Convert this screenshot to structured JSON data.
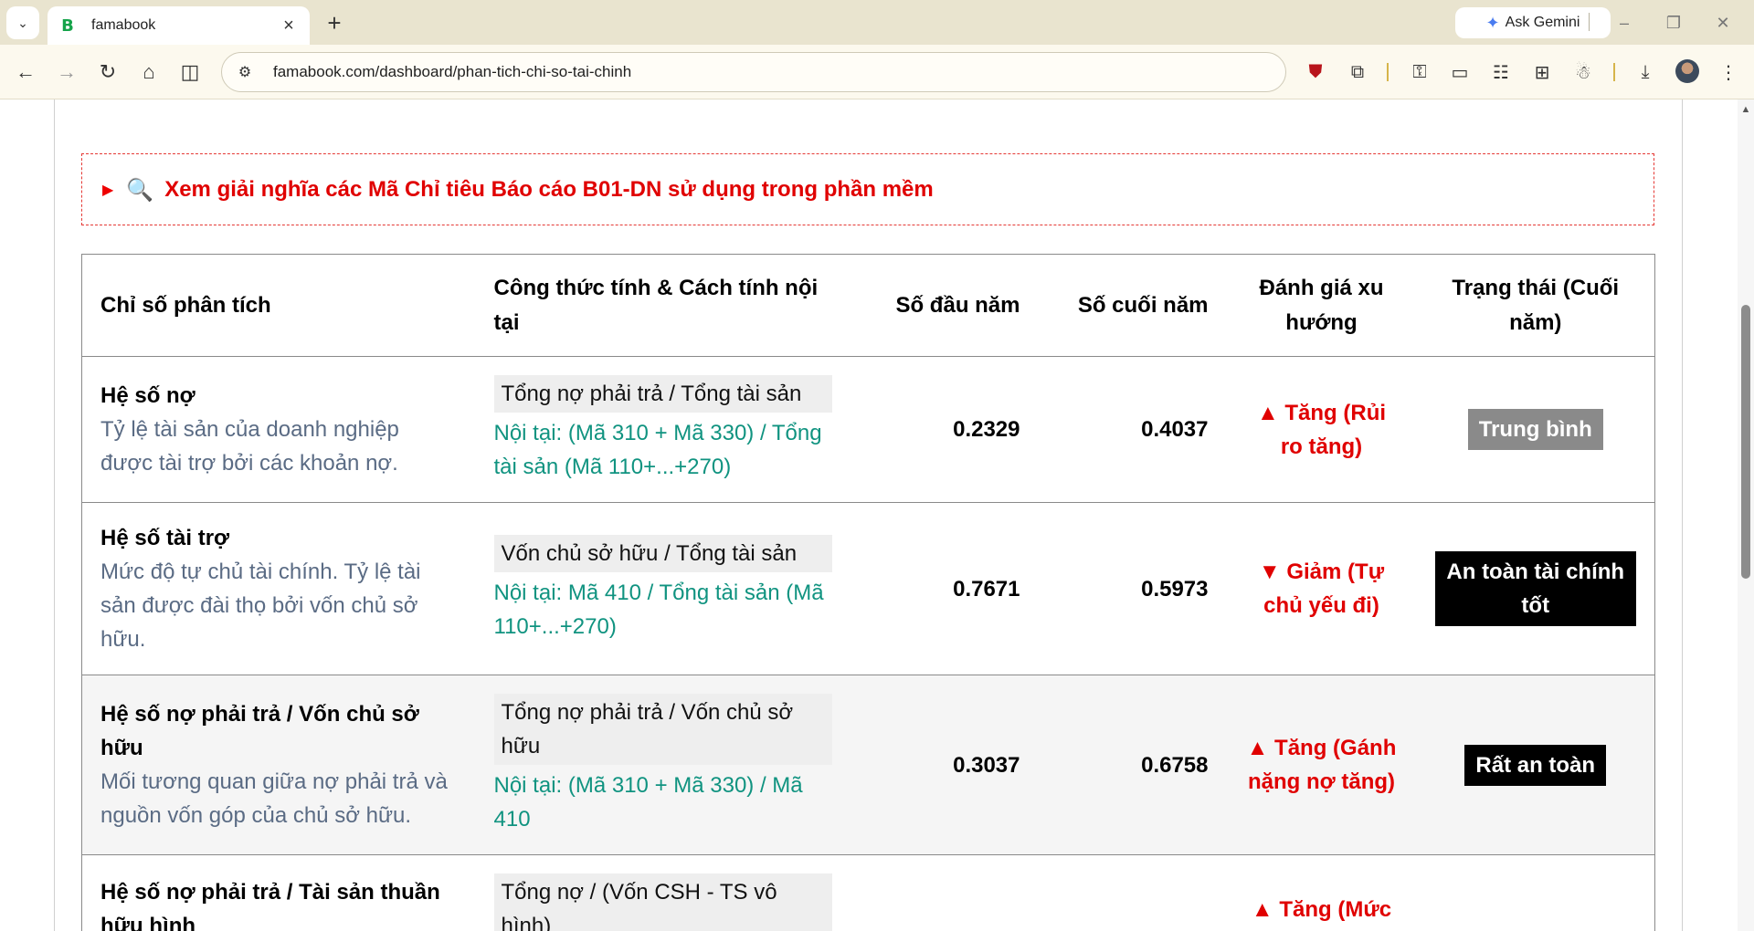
{
  "browser": {
    "tab_title": "famabook",
    "favicon_letter": "B",
    "url": "famabook.com/dashboard/phan-tich-chi-so-tai-chinh",
    "ask_gemini_label": "Ask Gemini",
    "accent_color": "#e9e4cf"
  },
  "explainer": {
    "arrow": "▶",
    "icon": "magnifier-icon",
    "text": "Xem giải nghĩa các Mã Chỉ tiêu Báo cáo B01-DN sử dụng trong phần mềm"
  },
  "table": {
    "headers": {
      "name": "Chỉ số phân tích",
      "formula": "Công thức tính & Cách tính nội tại",
      "start": "Số đầu năm",
      "end": "Số cuối năm",
      "trend": "Đánh giá xu hướng",
      "status": "Trạng thái (Cuối năm)"
    },
    "rows": [
      {
        "name": "Hệ số nợ",
        "desc": "Tỷ lệ tài sản của doanh nghiệp được tài trợ bởi các khoản nợ.",
        "formula": "Tổng nợ phải trả / Tổng tài sản",
        "detail": "Nội tại: (Mã 310 + Mã 330) / Tổng tài sản (Mã 110+...+270)",
        "start": "0.2329",
        "end": "0.4037",
        "trend": "▲ Tăng (Rủi ro tăng)",
        "status": "Trung bình"
      },
      {
        "name": "Hệ số tài trợ",
        "desc": "Mức độ tự chủ tài chính. Tỷ lệ tài sản được đài thọ bởi vốn chủ sở hữu.",
        "formula": "Vốn chủ sở hữu / Tổng tài sản",
        "detail": "Nội tại: Mã 410 / Tổng tài sản (Mã 110+...+270)",
        "start": "0.7671",
        "end": "0.5973",
        "trend": "▼ Giảm (Tự chủ yếu đi)",
        "status": "An toàn tài chính tốt"
      },
      {
        "name": "Hệ số nợ phải trả / Vốn chủ sở hữu",
        "desc": "Mối tương quan giữa nợ phải trả và nguồn vốn góp của chủ sở hữu.",
        "formula": "Tổng nợ phải trả / Vốn chủ sở hữu",
        "detail": "Nội tại: (Mã 310 + Mã 330) / Mã 410",
        "start": "0.3037",
        "end": "0.6758",
        "trend": "▲ Tăng (Gánh nặng nợ tăng)",
        "status": "Rất an toàn"
      },
      {
        "name": "Hệ số nợ phải trả / Tài sản thuần hữu hình",
        "desc": "",
        "formula": "Tổng nợ / (Vốn CSH - TS vô hình)",
        "detail": "",
        "start": "",
        "end": "",
        "trend": "▲ Tăng (Mức",
        "status": ""
      }
    ]
  },
  "colors": {
    "trend_red": "#e00000",
    "detail_teal": "#109380",
    "desc_slate": "#5a6b84",
    "badge_gray": "#8a8a8a",
    "badge_black": "#000000"
  }
}
